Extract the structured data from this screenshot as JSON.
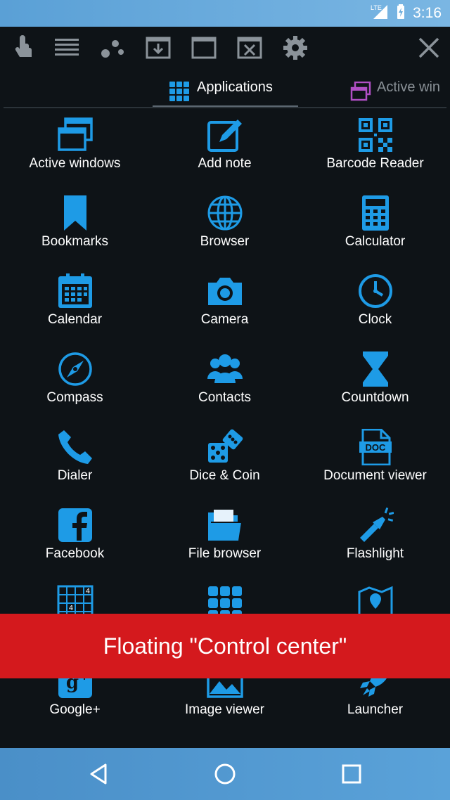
{
  "status_bar": {
    "network": "LTE",
    "time": "3:16"
  },
  "toolbar": {
    "icons": [
      "touch-icon",
      "list-icon",
      "dots-icon",
      "download-icon",
      "window-icon",
      "close-window-icon",
      "settings-gear-icon",
      "close-icon"
    ]
  },
  "tabs": {
    "applications": "Applications",
    "active_windows": "Active win"
  },
  "apps": [
    {
      "label": "Active windows",
      "icon": "active-windows-icon"
    },
    {
      "label": "Add note",
      "icon": "add-note-icon"
    },
    {
      "label": "Barcode Reader",
      "icon": "barcode-reader-icon"
    },
    {
      "label": "Bookmarks",
      "icon": "bookmarks-icon"
    },
    {
      "label": "Browser",
      "icon": "browser-icon"
    },
    {
      "label": "Calculator",
      "icon": "calculator-icon"
    },
    {
      "label": "Calendar",
      "icon": "calendar-icon"
    },
    {
      "label": "Camera",
      "icon": "camera-icon"
    },
    {
      "label": "Clock",
      "icon": "clock-icon"
    },
    {
      "label": "Compass",
      "icon": "compass-icon"
    },
    {
      "label": "Contacts",
      "icon": "contacts-icon"
    },
    {
      "label": "Countdown",
      "icon": "countdown-icon"
    },
    {
      "label": "Dialer",
      "icon": "dialer-icon"
    },
    {
      "label": "Dice & Coin",
      "icon": "dice-coin-icon"
    },
    {
      "label": "Document viewer",
      "icon": "document-viewer-icon"
    },
    {
      "label": "Facebook",
      "icon": "facebook-icon"
    },
    {
      "label": "File browser",
      "icon": "file-browser-icon"
    },
    {
      "label": "Flashlight",
      "icon": "flashlight-icon"
    },
    {
      "label": "Google+",
      "icon": "google-plus-icon"
    },
    {
      "label": "Image viewer",
      "icon": "image-viewer-icon"
    },
    {
      "label": "Launcher",
      "icon": "launcher-icon"
    }
  ],
  "banner": {
    "text": "Floating \"Control center\""
  },
  "colors": {
    "accent": "#1e9be6",
    "banner": "#d4191d",
    "background": "#0e1317",
    "status_bar": "#6aacdc"
  }
}
